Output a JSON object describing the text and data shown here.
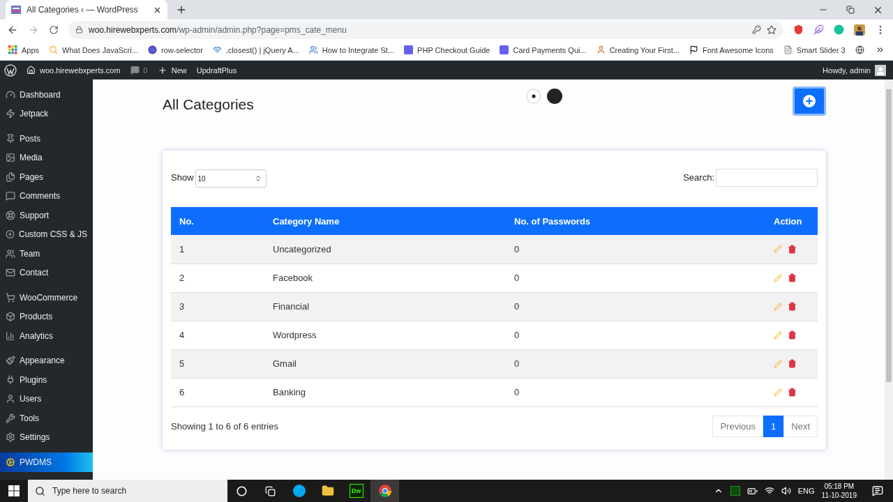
{
  "browser": {
    "tab_title": "All Categories ‹ — WordPress",
    "url_host": "woo.hirewebxperts.com",
    "url_path": "/wp-admin/admin.php?page=pms_cate_menu",
    "bookmarks": [
      "Apps",
      "What Does JavaScri...",
      "row-selector",
      ".closest() | jQuery A...",
      "How to Integrate St...",
      "PHP Checkout Guide",
      "Card Payments Qui...",
      "Creating Your First...",
      "Font Awesome Icons",
      "Smart Slider 3"
    ]
  },
  "admin_bar": {
    "site": "woo.hirewebxperts.com",
    "comments": "0",
    "new": "New",
    "plugin": "UpdraftPlus",
    "greeting": "Howdy, admin"
  },
  "sidebar": {
    "groups": [
      {
        "items": [
          {
            "label": "Dashboard",
            "selected": false
          },
          {
            "label": "Jetpack",
            "selected": false
          }
        ]
      },
      {
        "items": [
          {
            "label": "Posts",
            "selected": false
          },
          {
            "label": "Media",
            "selected": false
          },
          {
            "label": "Pages",
            "selected": false
          },
          {
            "label": "Comments",
            "selected": false
          },
          {
            "label": "Support",
            "selected": false
          },
          {
            "label": "Custom CSS & JS",
            "selected": false
          },
          {
            "label": "Team",
            "selected": false
          },
          {
            "label": "Contact",
            "selected": false
          }
        ]
      },
      {
        "items": [
          {
            "label": "WooCommerce",
            "selected": false
          },
          {
            "label": "Products",
            "selected": false
          },
          {
            "label": "Analytics",
            "selected": false
          }
        ]
      },
      {
        "items": [
          {
            "label": "Appearance",
            "selected": false
          },
          {
            "label": "Plugins",
            "selected": false
          },
          {
            "label": "Users",
            "selected": false
          },
          {
            "label": "Tools",
            "selected": false
          },
          {
            "label": "Settings",
            "selected": false
          }
        ]
      },
      {
        "items": [
          {
            "label": "PWDMS",
            "selected": true
          }
        ]
      }
    ]
  },
  "page": {
    "title": "All Categories",
    "show_label": "Show",
    "page_size": "10",
    "search_label": "Search:",
    "columns": [
      "No.",
      "Category Name",
      "No. of Passwords",
      "Action"
    ],
    "rows": [
      {
        "no": "1",
        "name": "Uncategorized",
        "passwords": "0"
      },
      {
        "no": "2",
        "name": "Facebook",
        "passwords": "0"
      },
      {
        "no": "3",
        "name": "Financial",
        "passwords": "0"
      },
      {
        "no": "4",
        "name": "Wordpress",
        "passwords": "0"
      },
      {
        "no": "5",
        "name": "Gmail",
        "passwords": "0"
      },
      {
        "no": "6",
        "name": "Banking",
        "passwords": "0"
      }
    ],
    "summary": "Showing 1 to 6 of 6 entries",
    "pagination": [
      {
        "label": "Previous",
        "selected": false
      },
      {
        "label": "1",
        "selected": true
      },
      {
        "label": "Next",
        "selected": false
      }
    ]
  },
  "taskbar": {
    "search_placeholder": "Type here to search",
    "dw_label": "Dw",
    "language": "ENG",
    "time": "05:18 PM",
    "date": "11-10-2019"
  }
}
